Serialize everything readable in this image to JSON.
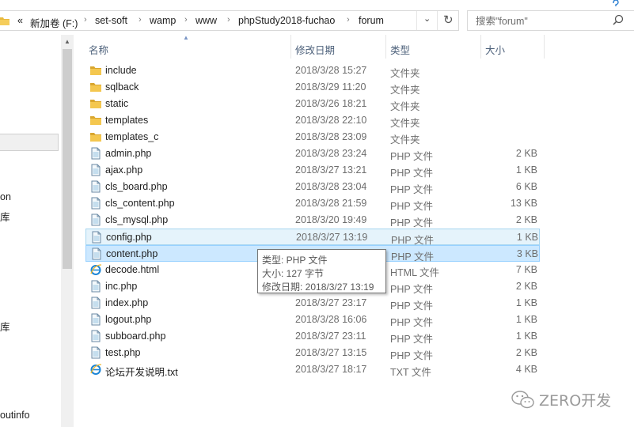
{
  "address_bar": {
    "overflow": "«",
    "crumbs": [
      "新加卷 (F:)",
      "set-soft",
      "wamp",
      "www",
      "phpStudy2018-fuchao",
      "forum"
    ],
    "separator": "›"
  },
  "search": {
    "placeholder": "搜索\"forum\""
  },
  "nav_pane": {
    "items": [
      "on",
      "库",
      "库",
      "outinfo"
    ]
  },
  "columns": {
    "name": "名称",
    "date": "修改日期",
    "type": "类型",
    "size": "大小"
  },
  "files": [
    {
      "name": "include",
      "date": "2018/3/28 15:27",
      "type": "文件夹",
      "size": "",
      "icon": "folder-icon"
    },
    {
      "name": "sqlback",
      "date": "2018/3/29 11:20",
      "type": "文件夹",
      "size": "",
      "icon": "folder-icon"
    },
    {
      "name": "static",
      "date": "2018/3/26 18:21",
      "type": "文件夹",
      "size": "",
      "icon": "folder-icon"
    },
    {
      "name": "templates",
      "date": "2018/3/28 22:10",
      "type": "文件夹",
      "size": "",
      "icon": "folder-icon"
    },
    {
      "name": "templates_c",
      "date": "2018/3/28 23:09",
      "type": "文件夹",
      "size": "",
      "icon": "folder-icon"
    },
    {
      "name": "admin.php",
      "date": "2018/3/28 23:24",
      "type": "PHP 文件",
      "size": "2 KB",
      "icon": "php-file-icon"
    },
    {
      "name": "ajax.php",
      "date": "2018/3/27 13:21",
      "type": "PHP 文件",
      "size": "1 KB",
      "icon": "php-file-icon"
    },
    {
      "name": "cls_board.php",
      "date": "2018/3/28 23:04",
      "type": "PHP 文件",
      "size": "6 KB",
      "icon": "php-file-icon"
    },
    {
      "name": "cls_content.php",
      "date": "2018/3/28 21:59",
      "type": "PHP 文件",
      "size": "13 KB",
      "icon": "php-file-icon"
    },
    {
      "name": "cls_mysql.php",
      "date": "2018/3/20 19:49",
      "type": "PHP 文件",
      "size": "2 KB",
      "icon": "php-file-icon"
    },
    {
      "name": "config.php",
      "date": "2018/3/27 13:19",
      "type": "PHP 文件",
      "size": "1 KB",
      "icon": "php-file-icon"
    },
    {
      "name": "content.php",
      "date": "",
      "type": "PHP 文件",
      "size": "3 KB",
      "icon": "php-file-icon"
    },
    {
      "name": "decode.html",
      "date": "",
      "type": "HTML 文件",
      "size": "7 KB",
      "icon": "ie-html-icon"
    },
    {
      "name": "inc.php",
      "date": "",
      "type": "PHP 文件",
      "size": "2 KB",
      "icon": "php-file-icon"
    },
    {
      "name": "index.php",
      "date": "2018/3/27 23:17",
      "type": "PHP 文件",
      "size": "1 KB",
      "icon": "php-file-icon"
    },
    {
      "name": "logout.php",
      "date": "2018/3/28 16:06",
      "type": "PHP 文件",
      "size": "1 KB",
      "icon": "php-file-icon"
    },
    {
      "name": "subboard.php",
      "date": "2018/3/27 23:11",
      "type": "PHP 文件",
      "size": "1 KB",
      "icon": "php-file-icon"
    },
    {
      "name": "test.php",
      "date": "2018/3/27 13:15",
      "type": "PHP 文件",
      "size": "2 KB",
      "icon": "php-file-icon"
    },
    {
      "name": "论坛开发说明.txt",
      "date": "2018/3/27 18:17",
      "type": "TXT 文件",
      "size": "4 KB",
      "icon": "ie-html-icon"
    }
  ],
  "hover_index": 10,
  "selected_index": 11,
  "tooltip": {
    "type": "类型: PHP 文件",
    "size": "大小: 127 字节",
    "modified": "修改日期: 2018/3/27 13:19"
  },
  "watermark": {
    "text": "ZERO开发",
    "icon": "wechat-icon"
  },
  "colors": {
    "folder": "#e8b93d",
    "selection": "#cce8ff",
    "hover": "#e5f3fb",
    "header_text": "#4c607a"
  }
}
